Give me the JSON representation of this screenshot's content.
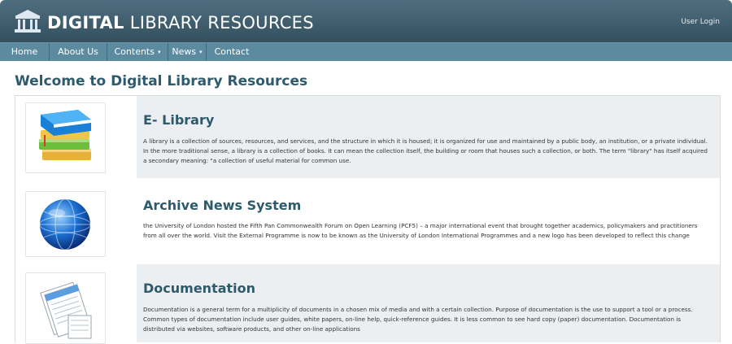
{
  "header": {
    "brand_bold": "DIGITAL",
    "brand_light": " LIBRARY RESOURCES",
    "user_login": "User Login"
  },
  "nav": {
    "items": [
      {
        "label": "Home"
      },
      {
        "label": "About Us"
      },
      {
        "label": "Contents"
      },
      {
        "label": "News"
      },
      {
        "label": "Contact"
      }
    ],
    "dropdown_caret": "▾"
  },
  "main": {
    "welcome": "Welcome to Digital Library Resources",
    "sections": [
      {
        "title": "E- Library",
        "icon": "books-icon",
        "text": "A library is a collection of sources, resources, and services, and the structure in which it is housed; it is organized for use and maintained by a public body, an institution, or a private individual. In the more traditional sense, a library is a collection of books. It can mean the collection itself, the building or room that houses such a collection, or both. The term \"library\" has itself acquired a secondary meaning: \"a collection of useful material for common use."
      },
      {
        "title": "Archive News System",
        "icon": "globe-icon",
        "text": "the University of London hosted the Fifth Pan Commonwealth Forum on Open Learning (PCF5) – a major international event that brought together academics, policymakers and practitioners from all over the world. Visit the External Programme is now to be known as the University of London International Programmes and a new logo has been developed to reflect this change"
      },
      {
        "title": "Documentation",
        "icon": "documents-icon",
        "text": "Documentation is a general term for a multiplicity of documents in a chosen mix of media and with a certain collection. Purpose of documentation is the use to support a tool or a process. Common types of documentation include user guides, white papers, on-line help, quick-reference guides. It is less common to see hard copy (paper) documentation. Documentation is distributed via websites, software products, and other on-line applications"
      }
    ]
  },
  "colors": {
    "header_dark": "#34505f",
    "nav_bar": "#5c8a9e",
    "title_teal": "#2d5a6c",
    "row_gray": "#eceff1"
  }
}
